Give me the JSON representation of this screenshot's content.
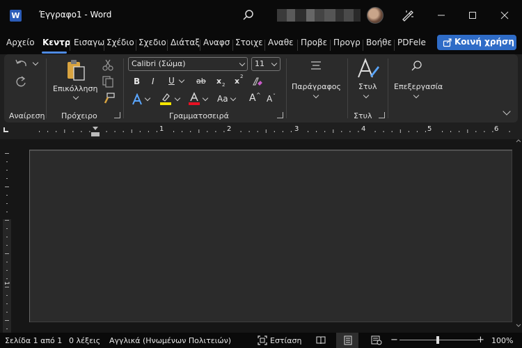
{
  "title_bar": {
    "doc_title": "Έγγραφο1  -  Word",
    "logo_letter": "W"
  },
  "tabs": [
    {
      "label": "Αρχείο"
    },
    {
      "label": "Κεντρ"
    },
    {
      "label": "Εισαγω"
    },
    {
      "label": "Σχέδιο"
    },
    {
      "label": "Σχεδιο"
    },
    {
      "label": "Διάταξ"
    },
    {
      "label": "Αναφσ"
    },
    {
      "label": "Στοιχε"
    },
    {
      "label": "Αναθε"
    },
    {
      "label": "Προβε"
    },
    {
      "label": "Προγρ"
    },
    {
      "label": "Βοήθε"
    },
    {
      "label": "PDFele"
    }
  ],
  "active_tab": "Κεντρ",
  "share": {
    "label": "Κοινή χρήση"
  },
  "ribbon": {
    "groups": {
      "undo": "Αναίρεση",
      "clipboard": "Πρόχειρο",
      "font": "Γραμματοσειρά",
      "styles": "Στυλ"
    },
    "paste_label": "Επικόλληση",
    "font_name": "Calibri (Σώμα)",
    "font_size": "11",
    "paragraph_label": "Παράγραφος",
    "styles_label": "Στυλ",
    "editing_label": "Επεξεργασία",
    "format_buttons": {
      "bold": "B",
      "italic": "I",
      "underline": "U",
      "strike": "ab",
      "sub": "x",
      "sup": "x"
    },
    "case_label": "Aa",
    "grow_label": "A",
    "shrink_label": "A",
    "accent_colors": {
      "highlight": "#f5e500",
      "font_color": "#e81123",
      "text_effects": "#5aa6ff"
    }
  },
  "ruler": {
    "numbers": [
      "1",
      "2",
      "3",
      "4",
      "5",
      "6"
    ]
  },
  "vruler": {
    "number": "1"
  },
  "status": {
    "page": "Σελίδα 1 από 1",
    "words": "0 λέξεις",
    "language": "Αγγλικά (Ηνωμένων Πολιτειών)",
    "focus": "Εστίαση",
    "zoom": "100%",
    "zoom_minus": "−",
    "zoom_plus": "+"
  }
}
